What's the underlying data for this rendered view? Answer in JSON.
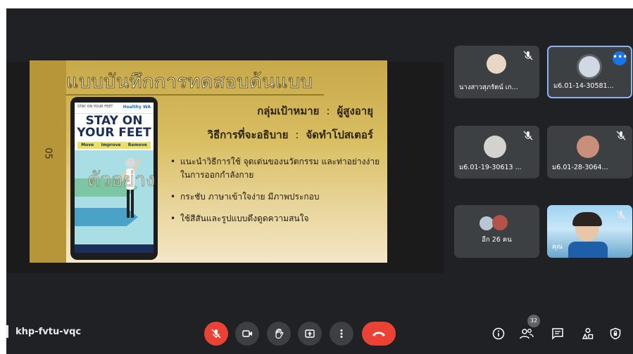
{
  "meeting": {
    "code": "khp-fvtu-vqc"
  },
  "slide": {
    "number": "05",
    "title": "แบบบันทึกการทดสอบต้นแบบ",
    "target_label": "กลุ่มเป้าหมาย",
    "target_value": "ผู้สูงอายุ",
    "method_label": "วิธีการที่จะอธิบาย",
    "method_value": "จัดทำโปสเตอร์",
    "separator": ":",
    "bullets": [
      "แนะนำวิธีการใช้ จุดเด่นของนวัตกรรม และท่าอย่างง่ายในการออกกำลังกาย",
      "กระชับ ภาษาเข้าใจง่าย มีภาพประกอบ",
      "ใช้สีสันและรูปแบบดึงดูดความสนใจ"
    ],
    "watermark": "ตัวอย่าง",
    "poster": {
      "title": "STAY ON YOUR FEET",
      "tabs": [
        "Move",
        "Improve",
        "Remove"
      ],
      "logo_left": "STAY ON YOUR FEET",
      "logo_right": "Healthy WA"
    }
  },
  "participants": [
    {
      "name": "นางสาวสุภรัตน์ เก...",
      "muted": true
    },
    {
      "name": "ม6.01-14-30581...",
      "muted": false,
      "active": true
    },
    {
      "name": "ม6.01-19-30613 ...",
      "muted": true
    },
    {
      "name": "ม6.01-28-3064...",
      "muted": true
    },
    {
      "name": "อีก 26 คน",
      "muted": false
    },
    {
      "name": "คุณ",
      "muted": true
    }
  ],
  "people_count": "32",
  "icons": {
    "mic": "mic-off-icon",
    "camera": "camera-icon",
    "hand": "raise-hand-icon",
    "present": "present-screen-icon",
    "more": "more-vert-icon",
    "leave": "end-call-icon",
    "info": "info-icon",
    "people": "people-icon",
    "chat": "chat-icon",
    "activities": "activities-icon",
    "safety": "host-controls-icon"
  },
  "colors": {
    "background": "#202124",
    "tile": "#3c4043",
    "danger": "#ea4335",
    "accent": "#8ab4f8",
    "primary": "#1a73e8"
  }
}
